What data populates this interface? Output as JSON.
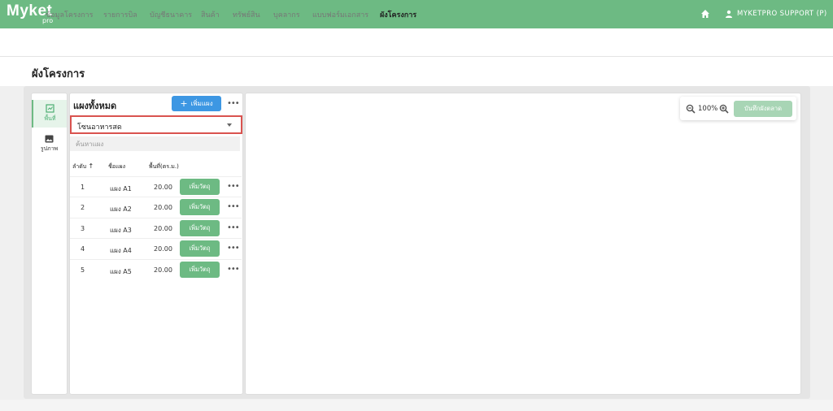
{
  "app": {
    "logo_text": "Myket",
    "logo_sub": "pro",
    "user_name": "MYKETPRO SUPPORT (P)"
  },
  "nav": {
    "items": [
      {
        "label": "ข้อมูลโครงการ"
      },
      {
        "label": "รายการบิล"
      },
      {
        "label": "บัญชีธนาคาร"
      },
      {
        "label": "สินค้า"
      },
      {
        "label": "ทรัพย์สิน"
      },
      {
        "label": "บุคลากร"
      },
      {
        "label": "แบบฟอร์มเอกสาร"
      },
      {
        "label": "ผังโครงการ"
      }
    ],
    "active_index": 7
  },
  "page": {
    "title": "ผังโครงการ"
  },
  "side_tabs": {
    "area_label": "พื้นที่",
    "image_label": "รูปภาพ"
  },
  "plots_panel": {
    "title": "แผงทั้งหมด",
    "add_button_label": "เพิ่มแผง",
    "zone_selected": "โซนอาหารสด",
    "search_placeholder": "ค้นหาแผง",
    "columns": {
      "order": "ลำดับ",
      "name": "ชื่อแผง",
      "area": "พื้นที่(ตร.ม.)"
    },
    "rows": [
      {
        "order": "1",
        "name": "แผง A1",
        "area": "20.00",
        "action": "เพิ่มวัตถุ"
      },
      {
        "order": "2",
        "name": "แผง A2",
        "area": "20.00",
        "action": "เพิ่มวัตถุ"
      },
      {
        "order": "3",
        "name": "แผง A3",
        "area": "20.00",
        "action": "เพิ่มวัตถุ"
      },
      {
        "order": "4",
        "name": "แผง A4",
        "area": "20.00",
        "action": "เพิ่มวัตถุ"
      },
      {
        "order": "5",
        "name": "แผง A5",
        "area": "20.00",
        "action": "เพิ่มวัตถุ"
      }
    ]
  },
  "canvas": {
    "zoom_level": "100%",
    "save_button_label": "บันทึกผังตลาด"
  },
  "colors": {
    "primary_green": "#6dba83",
    "primary_blue": "#3d97e3",
    "highlight_red": "#d9534f"
  },
  "icons": [
    "home-icon",
    "user-icon",
    "area-icon",
    "image-icon",
    "sort-up-icon",
    "zoom-out-icon",
    "zoom-in-icon",
    "more-icon",
    "caret-down-icon"
  ]
}
